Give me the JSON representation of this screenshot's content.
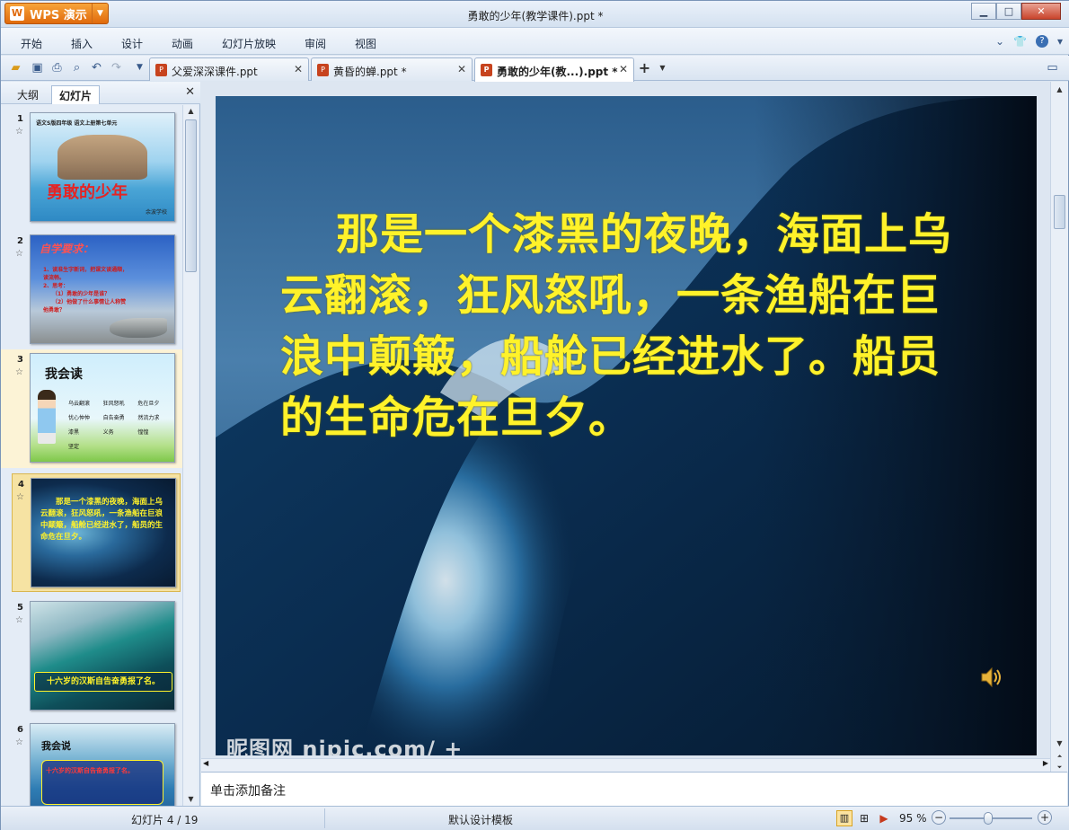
{
  "app": {
    "brand": "WPS 演示",
    "window_title": "勇敢的少年(教学课件).ppt *"
  },
  "menu": [
    "开始",
    "插入",
    "设计",
    "动画",
    "幻灯片放映",
    "审阅",
    "视图"
  ],
  "tabs": [
    {
      "label": "父爱深深课件.ppt",
      "active": false
    },
    {
      "label": "黄昏的蝉.ppt *",
      "active": false
    },
    {
      "label": "勇敢的少年(教...).ppt *",
      "active": true
    }
  ],
  "panel": {
    "tab_outline": "大纲",
    "tab_slides": "幻灯片"
  },
  "thumbnails": [
    {
      "num": "1",
      "title": "勇敢的少年",
      "top_caption": "语文S版四年级 语文上册第七单元",
      "author": "余波学校"
    },
    {
      "num": "2",
      "title": "自学要求：",
      "lines": [
        "1、读准生字新词，把课文读通顺，",
        "读流畅。",
        "2、思考：",
        "（1）勇敢的少年是谁？",
        "（2）他做了什么事情让人称赞",
        "他勇敢？"
      ]
    },
    {
      "num": "3",
      "title": "我会读",
      "words": [
        "乌云翻滚",
        "狂风怒吼",
        "危在旦夕",
        "忧心忡忡",
        "自告奋勇",
        "然流力求",
        "漆黑",
        "义务",
        "惶惶",
        "坚定"
      ]
    },
    {
      "num": "4",
      "text": "那是一个漆黑的夜晚，海面上乌云翻滚，狂风怒吼，一条渔船在巨浪中颠簸，船舱已经进水了，船员的生命危在旦夕。"
    },
    {
      "num": "5",
      "caption": "十六岁的汉斯自告奋勇报了名。"
    },
    {
      "num": "6",
      "title": "我会说",
      "caption": "十六岁的汉斯自告奋勇报了名。"
    }
  ],
  "slide": {
    "text": "那是一个漆黑的夜晚，海面上乌云翻滚，狂风怒吼，一条渔船在巨浪中颠簸，船舱已经进水了。船员的生命危在旦夕。",
    "watermark": "昵图网 nipic.com/ +"
  },
  "notes_placeholder": "单击添加备注",
  "status": {
    "slide_counter": "幻灯片 4 / 19",
    "template": "默认设计模板",
    "zoom": "95 %"
  },
  "colors": {
    "slide_text": "#fff22a",
    "accent_orange": "#e8780f",
    "selected_thumb": "#f6e3a3"
  }
}
